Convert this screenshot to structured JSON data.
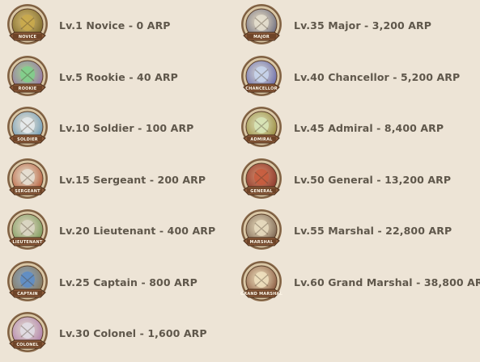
{
  "ranks_left": [
    {
      "text": "Lv.1 Novice - 0 ARP",
      "banner": "NOVICE",
      "icon": "novice-sprout-icon",
      "inner": "#7c6a2e",
      "accent": "#c9a94a"
    },
    {
      "text": "Lv.5 Rookie - 40 ARP",
      "banner": "ROOKIE",
      "icon": "rookie-frog-icon",
      "inner": "#9a72a8",
      "accent": "#7ed08a"
    },
    {
      "text": "Lv.10 Soldier - 100 ARP",
      "banner": "SOLDIER",
      "icon": "soldier-sword-icon",
      "inner": "#6d9ab4",
      "accent": "#e8ecef"
    },
    {
      "text": "Lv.15 Sergeant - 200 ARP",
      "banner": "SERGEANT",
      "icon": "sergeant-crossed-swords-icon",
      "inner": "#b85f3c",
      "accent": "#e8e2d6"
    },
    {
      "text": "Lv.20 Lieutenant - 400 ARP",
      "banner": "LIEUTENANT",
      "icon": "lieutenant-crossed-swords-icon",
      "inner": "#7a9a5a",
      "accent": "#dcd7c6"
    },
    {
      "text": "Lv.25 Captain - 800 ARP",
      "banner": "CAPTAIN",
      "icon": "captain-shield-icon",
      "inner": "#8a7a5a",
      "accent": "#5a8cc8"
    },
    {
      "text": "Lv.30 Colonel - 1,600 ARP",
      "banner": "COLONEL",
      "icon": "colonel-sword-icon",
      "inner": "#b07ea8",
      "accent": "#e2dee6"
    }
  ],
  "ranks_right": [
    {
      "text": "Lv.35 Major - 3,200 ARP",
      "banner": "MAJOR",
      "icon": "major-crossed-swords-icon",
      "inner": "#6b6b7e",
      "accent": "#e6e0d0"
    },
    {
      "text": "Lv.40 Chancellor - 5,200 ARP",
      "banner": "CHANCELLOR",
      "icon": "chancellor-swirl-icon",
      "inner": "#6a6aa8",
      "accent": "#c8d6ee"
    },
    {
      "text": "Lv.45 Admiral - 8,400 ARP",
      "banner": "ADMIRAL",
      "icon": "admiral-crossed-swords-icon",
      "inner": "#9a8a3e",
      "accent": "#d8e6b8"
    },
    {
      "text": "Lv.50 General - 13,200 ARP",
      "banner": "GENERAL",
      "icon": "general-emblem-icon",
      "inner": "#8a3a2e",
      "accent": "#c85a3c"
    },
    {
      "text": "Lv.55 Marshal - 22,800 ARP",
      "banner": "MARSHAL",
      "icon": "marshal-fleur-icon",
      "inner": "#7a6450",
      "accent": "#e8dcc0"
    },
    {
      "text": "Lv.60 Grand Marshal - 38,800 ARP",
      "banner": "GRAND MARSHAL",
      "icon": "grand-marshal-fleur-icon",
      "inner": "#8a5a40",
      "accent": "#f0e2c0"
    }
  ]
}
